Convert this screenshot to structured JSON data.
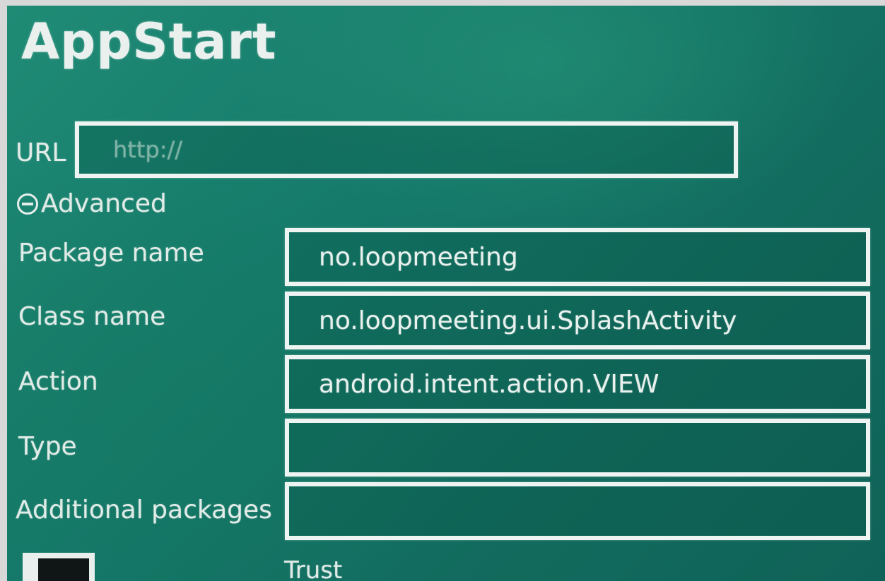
{
  "app": {
    "title": "AppStart"
  },
  "url": {
    "label": "URL",
    "placeholder": "http://",
    "value": ""
  },
  "advanced": {
    "toggle_label": "Advanced",
    "icon": "minus-circle-icon"
  },
  "fields": {
    "package_name": {
      "label": "Package name",
      "value": "no.loopmeeting"
    },
    "class_name": {
      "label": "Class name",
      "value": "no.loopmeeting.ui.SplashActivity"
    },
    "action": {
      "label": "Action",
      "value": "android.intent.action.VIEW"
    },
    "type": {
      "label": "Type",
      "value": ""
    },
    "additional_packages": {
      "label": "Additional packages",
      "value": ""
    }
  },
  "trust": {
    "label": "Trust",
    "checked": false
  },
  "colors": {
    "background": "#15796a",
    "text": "#e6f0ec",
    "border": "#eef4f2"
  }
}
